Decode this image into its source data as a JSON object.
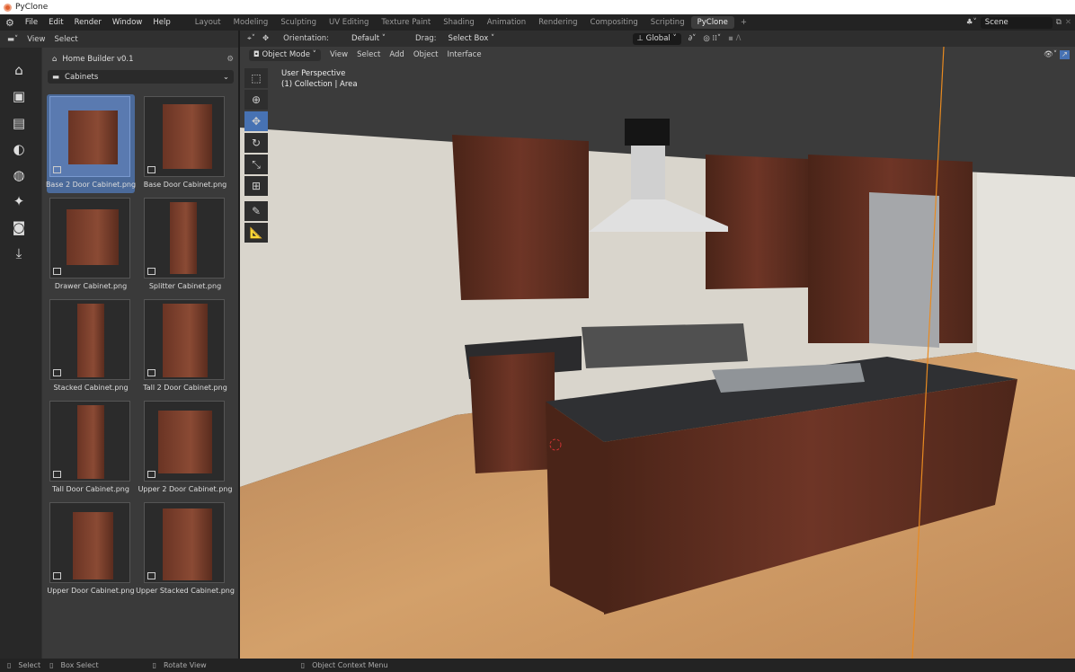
{
  "window": {
    "title": "PyClone"
  },
  "menu": [
    "File",
    "Edit",
    "Render",
    "Window",
    "Help"
  ],
  "workspaces": [
    "Layout",
    "Modeling",
    "Sculpting",
    "UV Editing",
    "Texture Paint",
    "Shading",
    "Animation",
    "Rendering",
    "Compositing",
    "Scripting",
    "PyClone"
  ],
  "active_workspace": "PyClone",
  "scene": {
    "label": "Scene"
  },
  "left_header": {
    "view": "View",
    "select": "Select"
  },
  "asset_panel": {
    "title": "Home Builder v0.1",
    "category": "Cabinets",
    "items": [
      {
        "label": "Base 2 Door Cabinet.png",
        "selected": true
      },
      {
        "label": "Base Door Cabinet.png"
      },
      {
        "label": "Drawer Cabinet.png"
      },
      {
        "label": "Splitter Cabinet.png"
      },
      {
        "label": "Stacked Cabinet.png"
      },
      {
        "label": "Tall 2 Door Cabinet.png"
      },
      {
        "label": "Tall Door Cabinet.png"
      },
      {
        "label": "Upper 2 Door Cabinet.png"
      },
      {
        "label": "Upper Door Cabinet.png"
      },
      {
        "label": "Upper Stacked Cabinet.png"
      }
    ]
  },
  "viewport_header": {
    "orientation_label": "Orientation:",
    "orientation": "Default",
    "drag_label": "Drag:",
    "drag": "Select Box",
    "transform": "Global"
  },
  "viewport_menu": {
    "mode": "Object Mode",
    "items": [
      "View",
      "Select",
      "Add",
      "Object",
      "Interface"
    ]
  },
  "viewport_overlay": {
    "perspective": "User Perspective",
    "collection": "(1) Collection | Area"
  },
  "status": {
    "select": "Select",
    "box_select": "Box Select",
    "rotate": "Rotate View",
    "context": "Object Context Menu"
  },
  "colors": {
    "accent": "#4772b3",
    "wood_cabinet": "#6a3424",
    "floor": "#c8965f",
    "wall": "#d9d5cc"
  }
}
